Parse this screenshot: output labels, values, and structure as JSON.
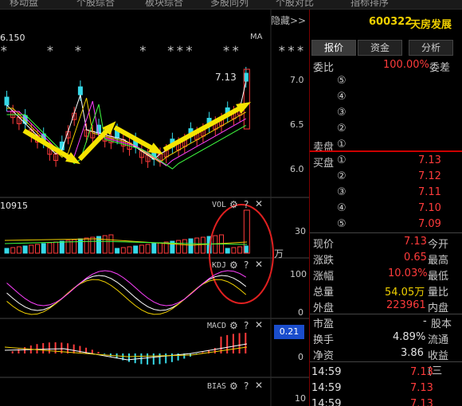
{
  "top_tabs": [
    {
      "label": "移动盘"
    },
    {
      "label": "个股综合"
    },
    {
      "label": "板块综合"
    },
    {
      "label": "多股同列"
    },
    {
      "label": "个股对比"
    },
    {
      "label": "指标排序"
    }
  ],
  "hide_button": "隐藏>>",
  "chart": {
    "price_label": "6.150",
    "ma_label": "MA",
    "stars": "*    *  *      *  ***   **    ***",
    "high_label": "7.13",
    "price_axis": [
      "7.0",
      "6.5",
      "6.0"
    ],
    "vol_title": "VOL",
    "vol_code": "10915",
    "vol_axis": [
      "30"
    ],
    "vol_unit": "万",
    "kdj_title": "KDJ",
    "kdj_axis": [
      "100",
      "0"
    ],
    "macd_title": "MACD",
    "macd_value": "0.21",
    "macd_axis": [
      "0"
    ],
    "bias_title": "BIAS",
    "bias_axis": [
      "10"
    ],
    "gear_icon": "gear-icon",
    "help_icon": "question-icon",
    "close_icon": "close-icon"
  },
  "stock": {
    "code": "600322",
    "name": "天房发展"
  },
  "info_tabs": [
    {
      "label": "报价",
      "active": true
    },
    {
      "label": "资金",
      "active": false
    },
    {
      "label": "分析",
      "active": false
    }
  ],
  "order_book": {
    "webi_label": "委比",
    "webi_value": "100.00%",
    "weicha_label": "委差",
    "sell_label": "卖盘",
    "buy_label": "买盘",
    "sell_levels": [
      "⑤",
      "④",
      "③",
      "②",
      "①"
    ],
    "buy_levels": [
      {
        "level": "①",
        "price": "7.13"
      },
      {
        "level": "②",
        "price": "7.12"
      },
      {
        "level": "③",
        "price": "7.11"
      },
      {
        "level": "④",
        "price": "7.10"
      },
      {
        "level": "⑤",
        "price": "7.09"
      }
    ]
  },
  "quote": [
    {
      "label": "现价",
      "value": "7.13",
      "value_color": "red",
      "label2": "今开"
    },
    {
      "label": "涨跌",
      "value": "0.65",
      "value_color": "red",
      "label2": "最高"
    },
    {
      "label": "涨幅",
      "value": "10.03%",
      "value_color": "red",
      "label2": "最低"
    },
    {
      "label": "总量",
      "value": "54.05万",
      "value_color": "yellow",
      "label2": "量比"
    },
    {
      "label": "外盘",
      "value": "223961",
      "value_color": "red",
      "label2": "内盘"
    }
  ],
  "fundamentals": [
    {
      "label": "市盈",
      "value": "-",
      "label2": "股本"
    },
    {
      "label": "换手",
      "value": "4.89%",
      "label2": "流通"
    },
    {
      "label": "净资",
      "value": "3.86",
      "label2": "收益(三"
    }
  ],
  "ticks": [
    {
      "time": "14:59",
      "price": "7.13"
    },
    {
      "time": "14:59",
      "price": "7.13"
    },
    {
      "time": "14:59",
      "price": "7.13"
    }
  ]
}
